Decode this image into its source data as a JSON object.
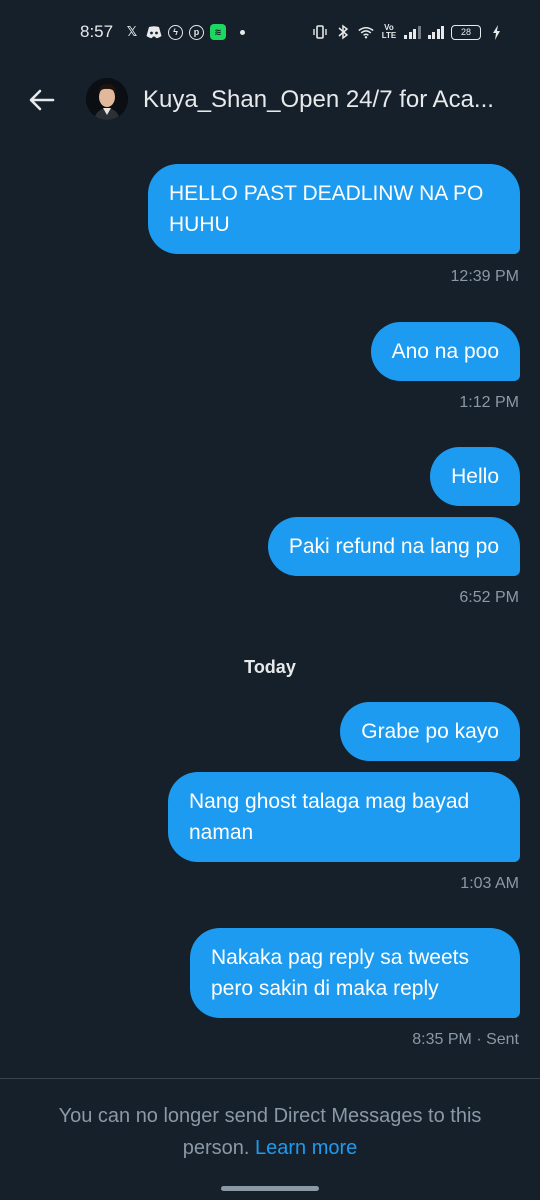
{
  "status_bar": {
    "time": "8:57",
    "left_icons": [
      "x-icon",
      "discord-icon",
      "messenger-icon",
      "pinterest-icon",
      "spotify-icon"
    ],
    "battery": "28"
  },
  "header": {
    "title": "Kuya_Shan_Open 24/7 for Aca..."
  },
  "messages": [
    {
      "text": "HELLO PAST DEADLINW NA PO HUHU",
      "meta": "12:39 PM"
    },
    {
      "text": "Ano na poo",
      "meta": "1:12 PM"
    },
    {
      "text": "Hello",
      "meta": ""
    },
    {
      "text": "Paki refund na lang po",
      "meta": "6:52 PM"
    },
    {
      "text": "Grabe po kayo",
      "meta": ""
    },
    {
      "text": "Nang ghost talaga mag bayad naman",
      "meta": "1:03 AM"
    },
    {
      "text": "Nakaka pag reply sa tweets pero sakin di maka reply",
      "meta": "8:35 PM · Sent"
    }
  ],
  "day_separator": "Today",
  "footer": {
    "notice": "You can no longer send Direct Messages to this person.",
    "link": "Learn more"
  },
  "colors": {
    "background": "#15202b",
    "bubble": "#1d9bf0",
    "muted_text": "#8b98a5",
    "link": "#1d9bf0"
  }
}
